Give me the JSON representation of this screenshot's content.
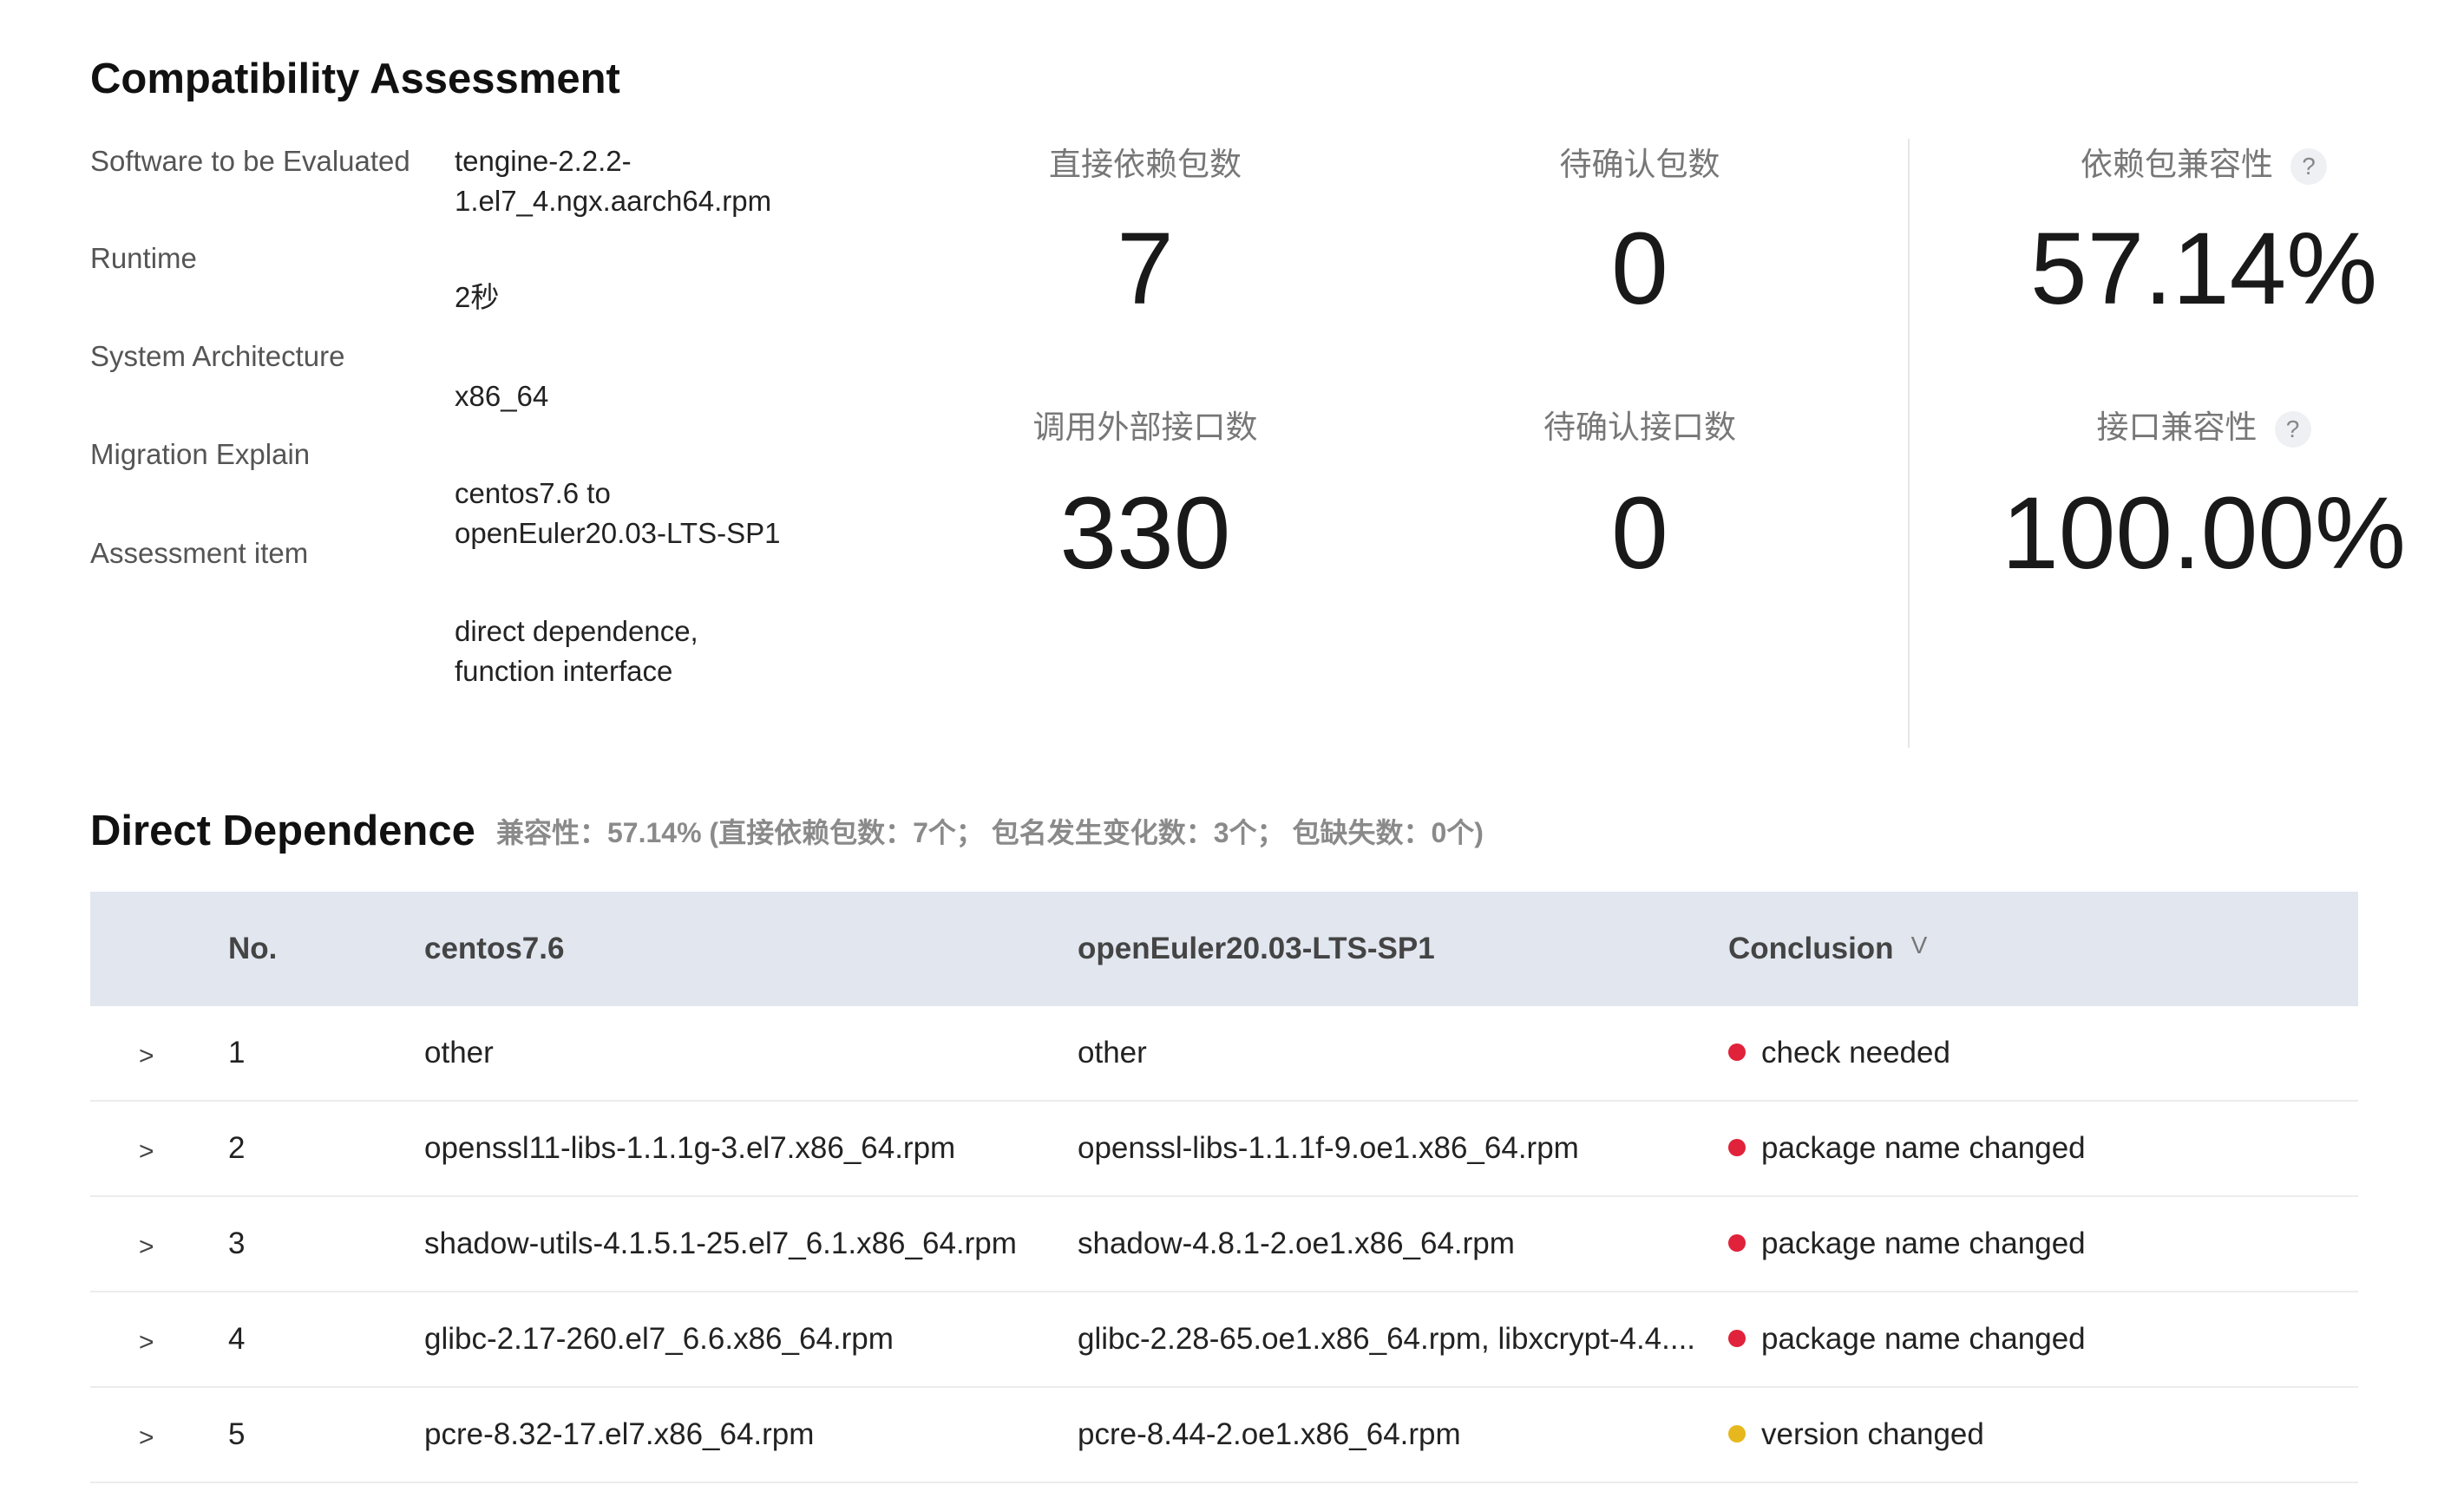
{
  "assessment": {
    "title": "Compatibility Assessment",
    "labels": [
      "Software to be Evaluated",
      "Runtime",
      "System Architecture",
      "Migration Explain",
      "Assessment item"
    ],
    "values": [
      "tengine-2.2.2-1.el7_4.ngx.aarch64.rpm",
      "2秒",
      "x86_64",
      "centos7.6 to openEuler20.03-LTS-SP1",
      "direct dependence, function interface"
    ]
  },
  "stats": {
    "direct_dep_label": "直接依赖包数",
    "direct_dep_value": "7",
    "pending_pkg_label": "待确认包数",
    "pending_pkg_value": "0",
    "ext_api_label": "调用外部接口数",
    "ext_api_value": "330",
    "pending_api_label": "待确认接口数",
    "pending_api_value": "0",
    "dep_compat_label": "依赖包兼容性",
    "dep_compat_value": "57.14%",
    "api_compat_label": "接口兼容性",
    "api_compat_value": "100.00%",
    "help_glyph": "?"
  },
  "direct_dependence": {
    "title": "Direct Dependence",
    "summary": "兼容性：57.14% (直接依赖包数：7个； 包名发生变化数：3个； 包缺失数：0个)",
    "columns": {
      "no": "No.",
      "source": "centos7.6",
      "target": "openEuler20.03-LTS-SP1",
      "conclusion": "Conclusion"
    },
    "expand_glyph": ">",
    "sort_glyph": "V",
    "rows": [
      {
        "no": "1",
        "source": "other",
        "target": "other",
        "conclusion": "check needed",
        "status_color": "#e0223a"
      },
      {
        "no": "2",
        "source": "openssl11-libs-1.1.1g-3.el7.x86_64.rpm",
        "target": "openssl-libs-1.1.1f-9.oe1.x86_64.rpm",
        "conclusion": "package name changed",
        "status_color": "#e0223a"
      },
      {
        "no": "3",
        "source": "shadow-utils-4.1.5.1-25.el7_6.1.x86_64.rpm",
        "target": "shadow-4.8.1-2.oe1.x86_64.rpm",
        "conclusion": "package name changed",
        "status_color": "#e0223a"
      },
      {
        "no": "4",
        "source": "glibc-2.17-260.el7_6.6.x86_64.rpm",
        "target": "glibc-2.28-65.oe1.x86_64.rpm, libxcrypt-4.4....",
        "conclusion": "package name changed",
        "status_color": "#e0223a"
      },
      {
        "no": "5",
        "source": "pcre-8.32-17.el7.x86_64.rpm",
        "target": "pcre-8.44-2.oe1.x86_64.rpm",
        "conclusion": "version changed",
        "status_color": "#e6b81e"
      }
    ]
  }
}
